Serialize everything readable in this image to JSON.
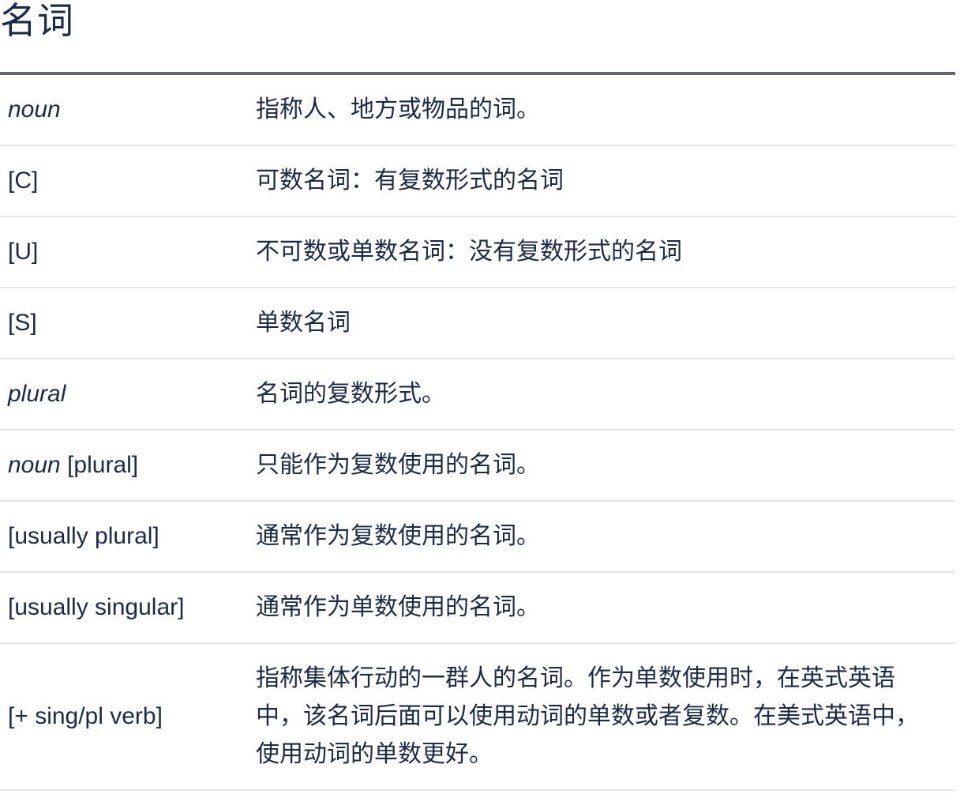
{
  "title": "名词",
  "rows": [
    {
      "term_italic": "noun",
      "term_rest": "",
      "definition": "指称人、地方或物品的词。"
    },
    {
      "term_italic": "",
      "term_rest": "[C]",
      "definition": "可数名词：有复数形式的名词"
    },
    {
      "term_italic": "",
      "term_rest": "[U]",
      "definition": "不可数或单数名词：没有复数形式的名词"
    },
    {
      "term_italic": "",
      "term_rest": "[S]",
      "definition": "单数名词"
    },
    {
      "term_italic": "plural",
      "term_rest": "",
      "definition": "名词的复数形式。"
    },
    {
      "term_italic": "noun",
      "term_rest": " [plural]",
      "definition": "只能作为复数使用的名词。"
    },
    {
      "term_italic": "",
      "term_rest": "[usually plural]",
      "definition": "通常作为复数使用的名词。"
    },
    {
      "term_italic": "",
      "term_rest": "[usually singular]",
      "definition": "通常作为单数使用的名词。"
    },
    {
      "term_italic": "",
      "term_rest": "[+ sing/pl verb]",
      "definition": "指称集体行动的一群人的名词。作为单数使用时，在英式英语中，该名词后面可以使用动词的单数或者复数。在美式英语中，使用动词的单数更好。"
    }
  ]
}
